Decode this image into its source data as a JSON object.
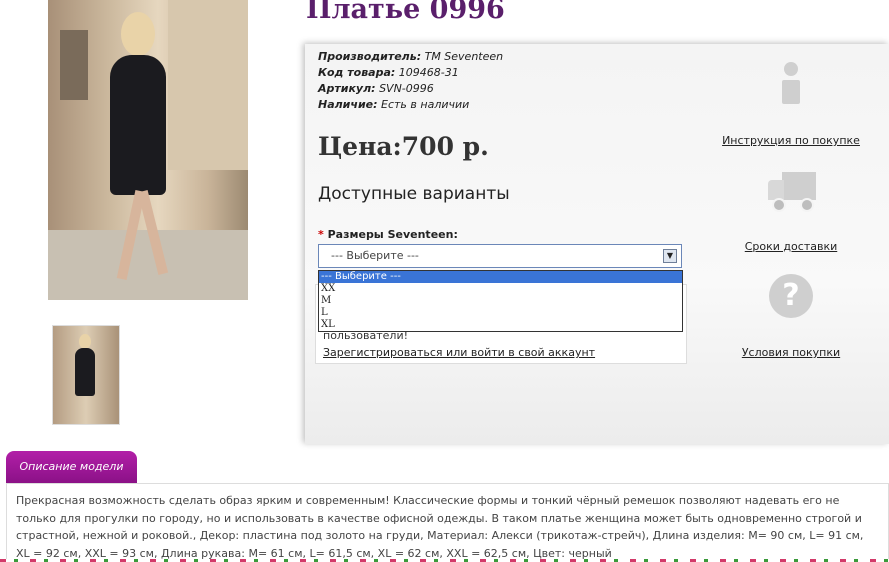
{
  "product": {
    "title": "Платье 0996",
    "manufacturer_label": "Производитель:",
    "manufacturer_value": "TM Seventeen",
    "code_label": "Код товара:",
    "code_value": "109468-31",
    "article_label": "Артикул:",
    "article_value": "SVN-0996",
    "availability_label": "Наличие:",
    "availability_value": "Есть в наличии",
    "price": "Цена:700 р."
  },
  "variants": {
    "heading": "Доступные варианты",
    "required_mark": "*",
    "size_label": "Размеры Seventeen:",
    "select_value": "--- Выберите ---",
    "options": [
      "--- Выберите ---",
      "XX",
      "M",
      "L",
      "XL"
    ],
    "selected_index": 0
  },
  "login": {
    "message": "пользователи!",
    "link": "Зарегистрироваться или войти в свой аккаунт"
  },
  "sidebar": {
    "instructions": "Инструкция по покупке",
    "delivery": "Сроки доставки",
    "conditions": "Условия покупки"
  },
  "description": {
    "tab": "Описание модели",
    "text": "Прекрасная возможность сделать образ ярким и современным! Классические формы и тонкий чёрный ремешок позволяют надевать его не только для прогулки по городу, но и использовать в качестве офисной одежды. В таком платье женщина может быть одновременно строгой и страстной, нежной и роковой., Декор: пластина под золото на груди, Материал: Алекси (трикотаж-стрейч), Длина изделия: M= 90 см, L= 91 см, XL = 92 см, XXL = 93 см, Длина рукава: M= 61 см, L= 61,5 см, XL = 62 см, XXL = 62,5 см, Цвет: черный"
  },
  "icons": {
    "info": "info-icon",
    "delivery": "truck-icon",
    "help": "question-icon",
    "dropdown": "chevron-down-icon"
  },
  "colors": {
    "title": "#5a1f6b",
    "tab": "#a01a9b",
    "selected_option": "#3a74d6"
  }
}
